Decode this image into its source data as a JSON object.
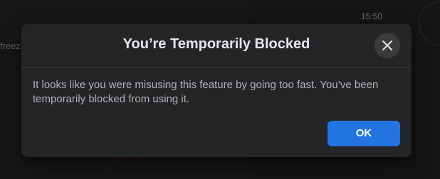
{
  "background": {
    "timestamp": "15:50",
    "message_snippet": "freez"
  },
  "dialog": {
    "title": "You’re Temporarily Blocked",
    "message": "It looks like you were misusing this feature by going too fast. You’ve been temporarily blocked from using it.",
    "close_icon": "close-icon",
    "ok_label": "OK"
  },
  "colors": {
    "dialog_bg": "#242526",
    "primary_button": "#2374e1",
    "title_text": "#e4e6eb",
    "body_text": "#b0b3b8"
  }
}
